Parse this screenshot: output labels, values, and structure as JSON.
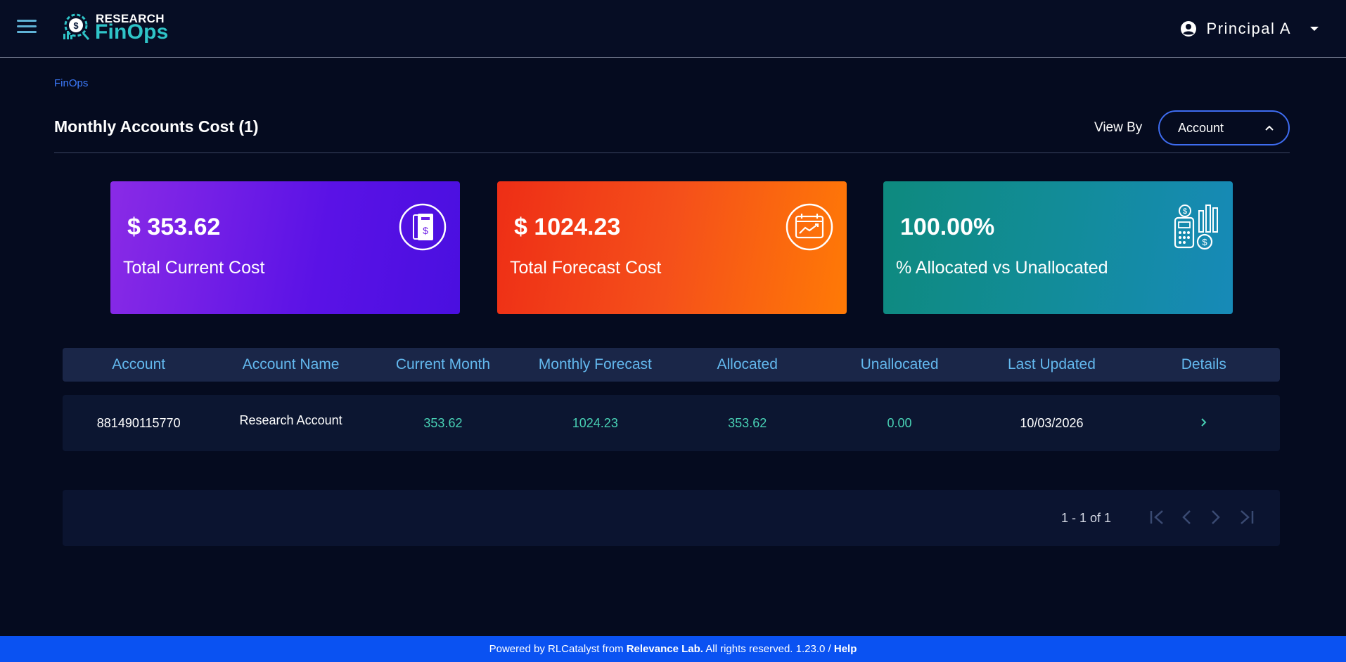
{
  "header": {
    "logo_top": "RESEARCH",
    "logo_bottom": "FinOps",
    "user_name": "Principal A"
  },
  "breadcrumb": {
    "item": "FinOps"
  },
  "page": {
    "title": "Monthly Accounts Cost (1)",
    "view_by_label": "View By",
    "view_by_value": "Account"
  },
  "cards": [
    {
      "value": "$ 353.62",
      "label": "Total Current Cost",
      "icon": "receipt-dollar-icon"
    },
    {
      "value": "$ 1024.23",
      "label": "Total Forecast Cost",
      "icon": "forecast-chart-icon"
    },
    {
      "value": "100.00%",
      "label": "% Allocated vs Unallocated",
      "icon": "calculator-dollar-icon"
    }
  ],
  "table": {
    "columns": [
      "Account",
      "Account Name",
      "Current Month",
      "Monthly Forecast",
      "Allocated",
      "Unallocated",
      "Last Updated",
      "Details"
    ],
    "rows": [
      {
        "account": "881490115770",
        "account_name": "Research Account",
        "current_month": "353.62",
        "monthly_forecast": "1024.23",
        "allocated": "353.62",
        "unallocated": "0.00",
        "last_updated": "10/03/2026",
        "details": "›"
      }
    ]
  },
  "pagination": {
    "range": "1 - 1 of 1"
  },
  "footer": {
    "prefix": "Powered by RLCatalyst from ",
    "company": "Relevance Lab.",
    "middle": " All rights reserved. 1.23.0 / ",
    "help": "Help"
  },
  "colors": {
    "background": "#050b1f",
    "accent": "#3e6cf0",
    "teal_values": "#48d0b4",
    "header_text": "#63b8ee",
    "footer": "#0a52f2"
  }
}
